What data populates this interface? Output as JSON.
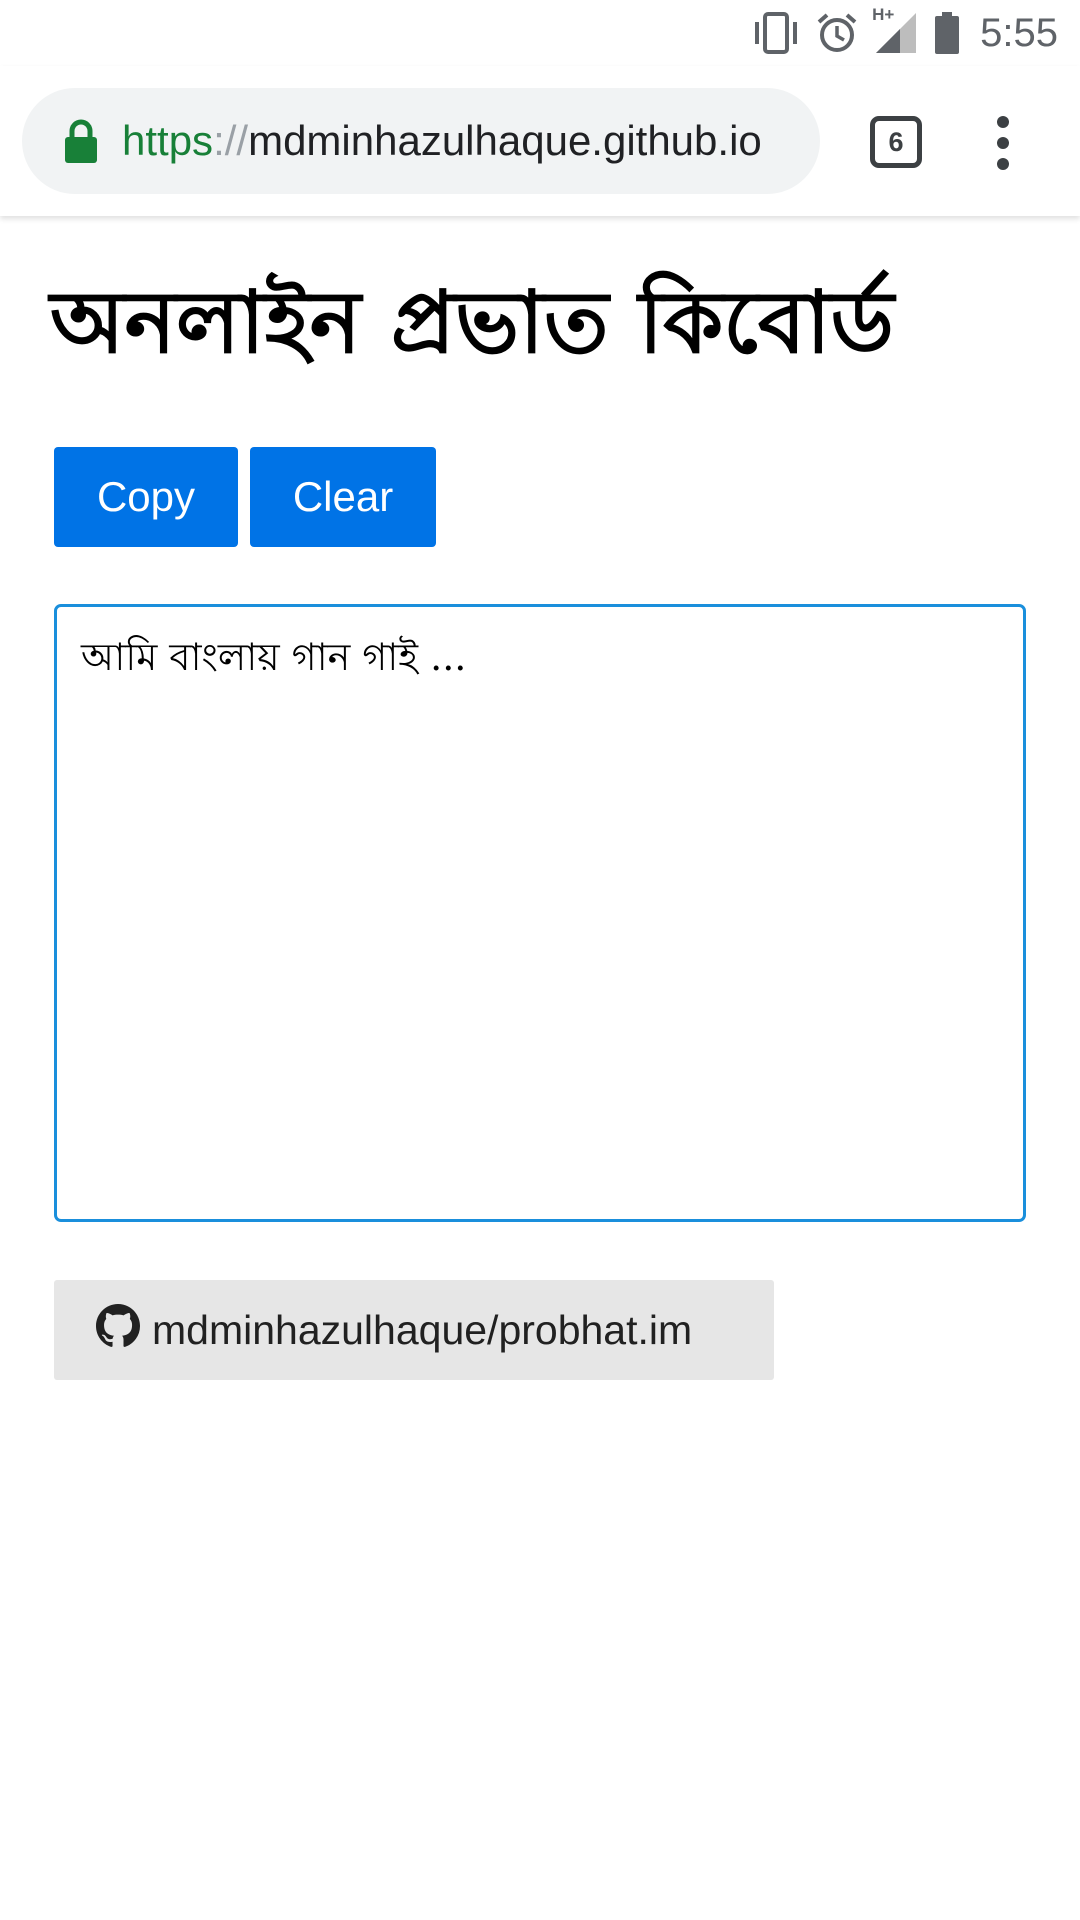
{
  "status_bar": {
    "network_label": "H+",
    "time": "5:55",
    "icons": [
      "vibrate-icon",
      "alarm-icon",
      "signal-icon",
      "battery-icon"
    ]
  },
  "browser": {
    "url": {
      "scheme": "https",
      "separator": "://",
      "host": "mdminhazulhaque.github.io"
    },
    "tab_count": "6",
    "colors": {
      "secure_scheme": "#188038",
      "omnibox_bg": "#f1f3f4"
    }
  },
  "page": {
    "title": "অনলাইন প্রভাত কিবোর্ড",
    "buttons": {
      "copy": "Copy",
      "clear": "Clear"
    },
    "editor": {
      "value": "আমি বাংলায় গান গাই ..."
    },
    "repo_link": {
      "label": "mdminhazulhaque/probhat.im",
      "icon": "github-icon"
    },
    "colors": {
      "button_bg": "#0073e6",
      "editor_border": "#1a8fdc",
      "repo_bg": "#e6e6e6"
    }
  }
}
